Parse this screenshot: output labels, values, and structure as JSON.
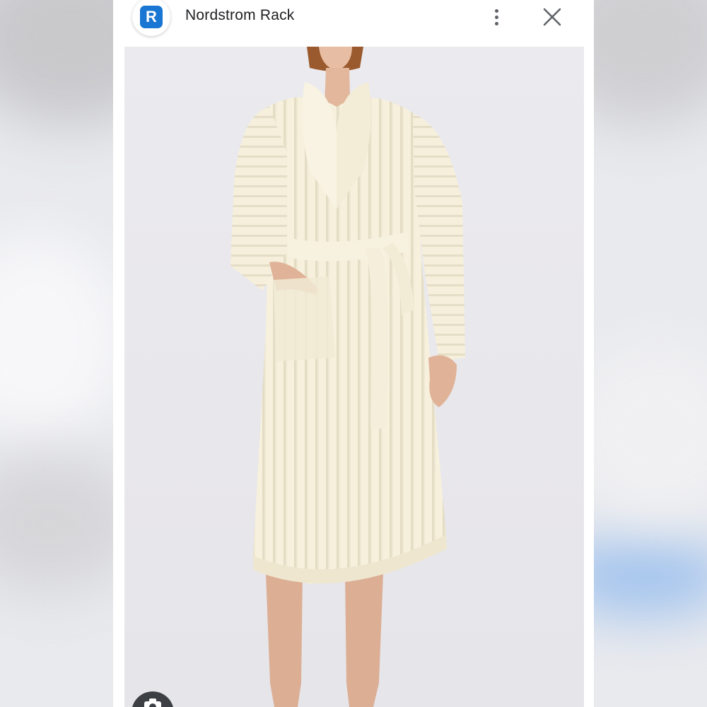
{
  "header": {
    "app_title": "Nordstrom Rack",
    "logo_letter": "R",
    "logo_icon": "nordstrom-rack-logo-icon",
    "more_icon": "more-vert-icon",
    "close_icon": "close-icon"
  },
  "image": {
    "subject_icon": "product-photo",
    "search_icon": "lens-camera-icon"
  },
  "colors": {
    "logo_blue": "#1976d2",
    "icon_gray": "#5f6368",
    "photo_bg": "#ececf0",
    "robe": "#f6f0dd"
  }
}
